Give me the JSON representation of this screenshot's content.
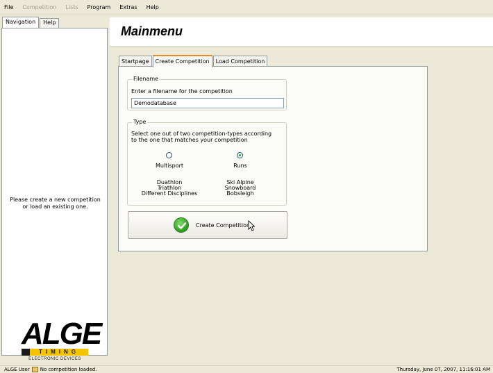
{
  "menu": [
    "File",
    "Competition",
    "Lists",
    "Program",
    "Extras",
    "Help"
  ],
  "menu_disabled": [
    "Competition",
    "Lists"
  ],
  "left_tabs": [
    "Navigation",
    "Help"
  ],
  "left_info": "Please create a new competition or load an existing one.",
  "logo": {
    "word": "ALGE",
    "bar": "TIMING",
    "sub": "ELECTRONIC DEVICES"
  },
  "header": {
    "title": "Mainmenu"
  },
  "tabs": [
    "Startpage",
    "Create Competition",
    "Load Competition"
  ],
  "active_tab": "Create Competition",
  "filename_group": {
    "title": "Filename",
    "prompt": "Enter a filename for the competition",
    "value": "Demodatabase"
  },
  "type_group": {
    "title": "Type",
    "description_line1": "Select one out of two competition-types according",
    "description_line2": "to the one that matches your competition",
    "options": [
      {
        "label": "Multisport",
        "selected": false,
        "examples": [
          "Duathlon",
          "Triathlon",
          "Different Disciplines"
        ]
      },
      {
        "label": "Runs",
        "selected": true,
        "examples": [
          "Ski Alpine",
          "Snowboard",
          "Bobsleigh"
        ]
      }
    ]
  },
  "create_button": {
    "label": "Create Competition",
    "icon": "green-check-icon"
  },
  "status": {
    "user": "ALGE User",
    "message": "No competition loaded.",
    "datetime": "Thursday, June 07, 2007, 11:16:01 AM"
  },
  "colors": {
    "accent_tab": "#e68b2c",
    "check": "#2f9a1e",
    "logo_yellow": "#f5c400"
  }
}
